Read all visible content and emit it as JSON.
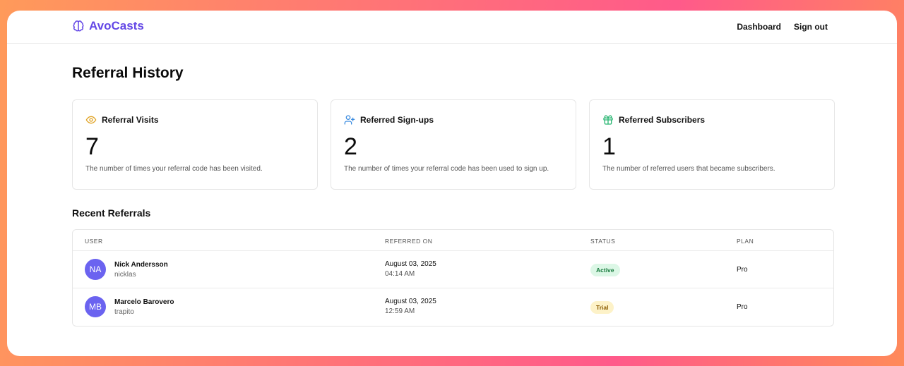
{
  "brand": {
    "name": "AvoCasts",
    "color": "#6347e6"
  },
  "nav": {
    "dashboard": "Dashboard",
    "signout": "Sign out"
  },
  "page": {
    "title": "Referral History"
  },
  "stats": [
    {
      "icon": "eye-icon",
      "label": "Referral Visits",
      "value": "7",
      "desc": "The number of times your referral code has been visited.",
      "color": "#e0a325"
    },
    {
      "icon": "user-plus-icon",
      "label": "Referred Sign-ups",
      "value": "2",
      "desc": "The number of times your referral code has been used to sign up.",
      "color": "#3b8ce0"
    },
    {
      "icon": "gift-icon",
      "label": "Referred Subscribers",
      "value": "1",
      "desc": "The number of referred users that became subscribers.",
      "color": "#2bb673"
    }
  ],
  "recent": {
    "title": "Recent Referrals",
    "headers": {
      "user": "USER",
      "referred_on": "REFERRED ON",
      "status": "STATUS",
      "plan": "PLAN"
    },
    "rows": [
      {
        "initials": "NA",
        "name": "Nick Andersson",
        "handle": "nicklas",
        "date": "August 03, 2025",
        "time": "04:14 AM",
        "status": "Active",
        "plan": "Pro"
      },
      {
        "initials": "MB",
        "name": "Marcelo Barovero",
        "handle": "trapito",
        "date": "August 03, 2025",
        "time": "12:59 AM",
        "status": "Trial",
        "plan": "Pro"
      }
    ]
  }
}
